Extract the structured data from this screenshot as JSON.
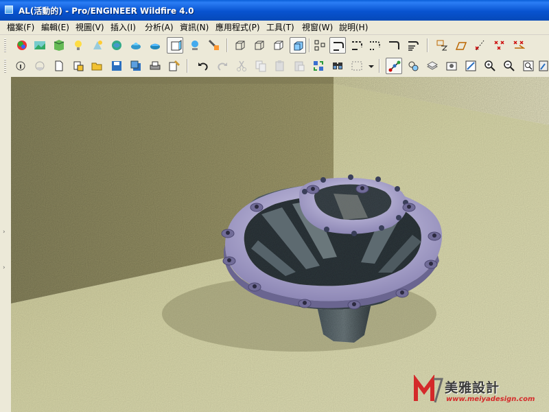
{
  "window": {
    "title": "AL(活動的) - Pro/ENGINEER Wildfire 4.0"
  },
  "menubar": {
    "items": [
      {
        "label": "檔案(F)"
      },
      {
        "label": "編輯(E)"
      },
      {
        "label": "視圖(V)"
      },
      {
        "label": "插入(I)"
      },
      {
        "label": "分析(A)"
      },
      {
        "label": "資訊(N)"
      },
      {
        "label": "應用程式(P)"
      },
      {
        "label": "工具(T)"
      },
      {
        "label": "視窗(W)"
      },
      {
        "label": "說明(H)"
      }
    ]
  },
  "toolbar1": {
    "icons": [
      "appearance-gallery-icon",
      "scene-editor-icon",
      "room-editor-icon",
      "lights-icon",
      "effects-icon",
      "render-setup-icon",
      "render-window-icon",
      "render-region-icon",
      "model-display-icon",
      "spot-light-icon",
      "render-settings-icon",
      "wireframe-icon",
      "hidden-line-icon",
      "no-hidden-icon",
      "shading-icon",
      "datum-planes-icon",
      "datum-axes-icon",
      "datum-points-icon",
      "coordinate-systems-icon",
      "spin-center-icon",
      "annotation-display-icon",
      "datum-plane-tool-icon",
      "datum-axis-tool-icon",
      "datum-point-tool-icon",
      "csys-tool-icon"
    ]
  },
  "toolbar2": {
    "icons": [
      "new-icon",
      "open-icon",
      "save-icon",
      "save-copy-icon",
      "print-icon",
      "undo-icon",
      "redo-icon",
      "cut-icon",
      "copy-icon",
      "paste-icon",
      "paste-special-icon",
      "regenerate-icon",
      "find-icon",
      "selection-filter-icon",
      "view-manager-icon",
      "saved-views-icon",
      "refit-icon",
      "zoom-in-icon",
      "zoom-out-icon",
      "fit-window-icon",
      "repaint-icon"
    ]
  },
  "watermark": {
    "name": "美雅設計",
    "url": "www.meiyadesign.com"
  }
}
